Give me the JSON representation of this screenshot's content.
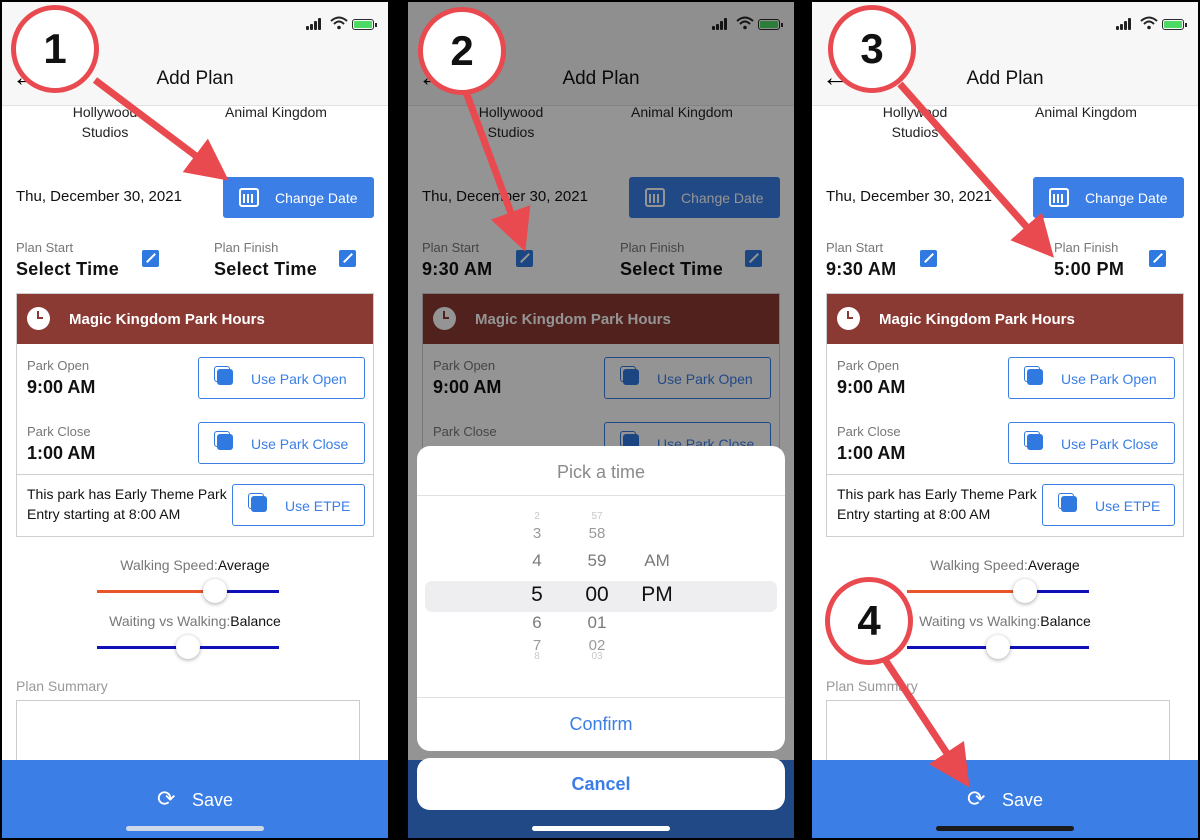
{
  "header_title": "Add Plan",
  "back_glyph": "←",
  "parks": {
    "park1": "Hollywood Studios",
    "park2": "Animal Kingdom"
  },
  "date": "Thu, December 30, 2021",
  "change_date_label": "Change Date",
  "plan_start_label": "Plan Start",
  "plan_finish_label": "Plan Finish",
  "select_time": "Select Time",
  "start_time_set": "9:30 AM",
  "finish_time_set": "5:00 PM",
  "park_hours": {
    "title": "Magic Kingdom Park Hours",
    "open_label": "Park Open",
    "open_value": "9:00 AM",
    "use_open": "Use Park Open",
    "close_label": "Park Close",
    "close_value": "1:00 AM",
    "use_close": "Use Park Close",
    "etpe_text": "This park has Early Theme Park Entry starting at 8:00 AM",
    "use_etpe": "Use ETPE"
  },
  "walking_speed": {
    "label": "Walking Speed:",
    "value": "Average",
    "level_percent": 65
  },
  "wait_vs_walk": {
    "label": "Waiting vs Walking:",
    "value": "Balance",
    "level_percent": 50
  },
  "plan_summary_label": "Plan Summary",
  "save_label": "Save",
  "picker": {
    "title": "Pick a time",
    "hours": [
      "2",
      "3",
      "4",
      "5",
      "6",
      "7",
      "8"
    ],
    "minutes": [
      "57",
      "58",
      "59",
      "00",
      "01",
      "02",
      "03"
    ],
    "ampm": [
      "AM",
      "PM"
    ],
    "selected": {
      "hour": "5",
      "minute": "00",
      "ampm": "PM"
    },
    "confirm": "Confirm",
    "cancel": "Cancel"
  },
  "callouts": [
    "1",
    "2",
    "3",
    "4"
  ],
  "colors": {
    "accent": "#3a7ee6",
    "header_maroon": "#8b3a33",
    "callout_red": "#e84a4f",
    "speed_fill": "#e8552a",
    "track": "#1010b8"
  }
}
